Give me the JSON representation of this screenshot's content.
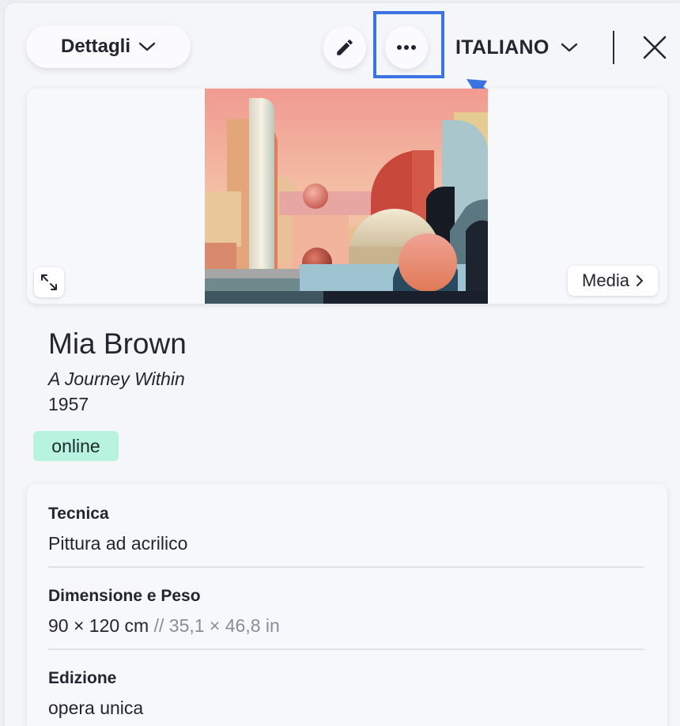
{
  "header": {
    "details_label": "Dettagli",
    "language_label": "ITALIANO"
  },
  "media": {
    "media_label": "Media"
  },
  "artwork": {
    "artist": "Mia Brown",
    "title": "A Journey Within",
    "year": "1957",
    "status": "online"
  },
  "details": {
    "technique_label": "Tecnica",
    "technique_value": "Pittura ad acrilico",
    "dimensions_label": "Dimensione e Peso",
    "dimensions_cm": "90 × 120 cm",
    "dimensions_in": "// 35,1 × 46,8 in",
    "edition_label": "Edizione",
    "edition_value": "opera unica"
  },
  "colors": {
    "highlight": "#3b73e0",
    "status_bg": "#b7f3df",
    "panel_bg": "#f5f6fa"
  },
  "icons": [
    "chevron-down-icon",
    "pencil-icon",
    "more-horizontal-icon",
    "close-icon",
    "expand-icon",
    "chevron-right-icon",
    "annotation-arrow"
  ]
}
